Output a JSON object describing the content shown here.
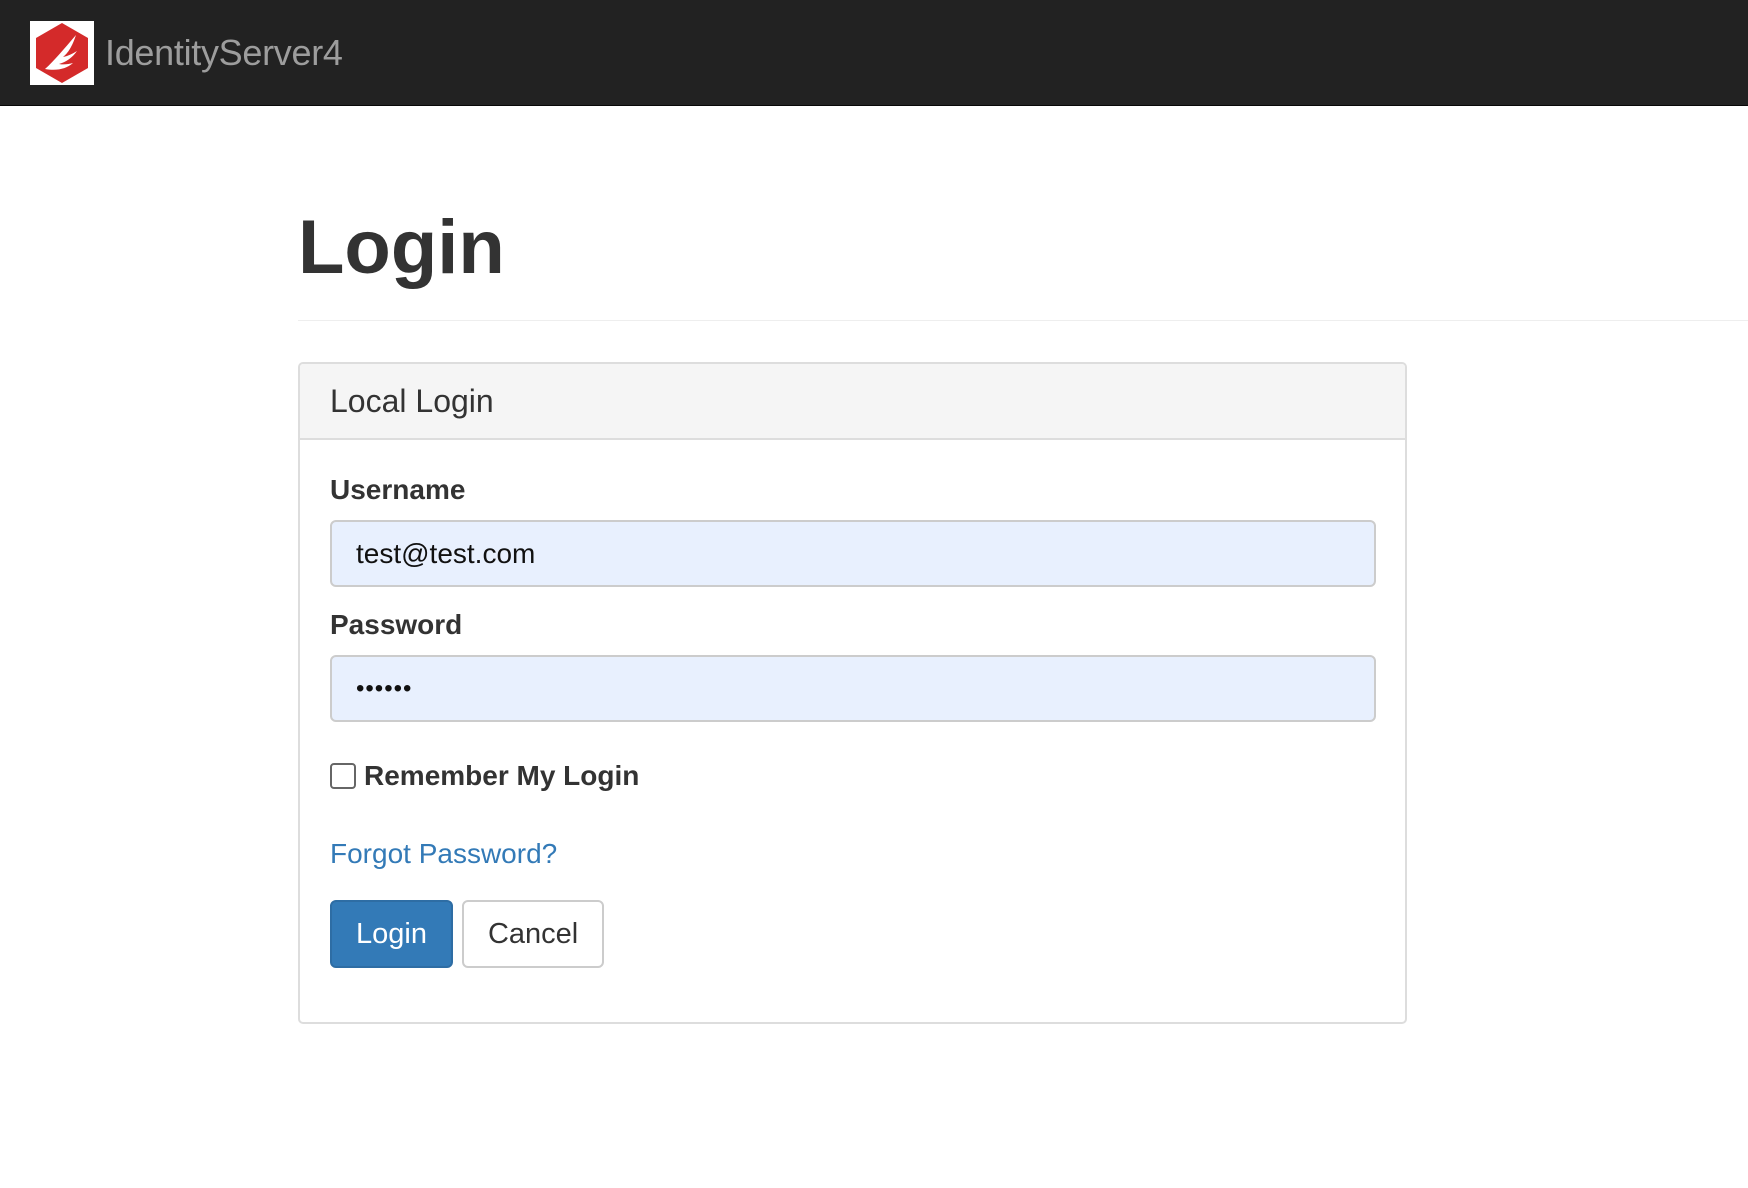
{
  "navbar": {
    "brand_name": "IdentityServer4",
    "logo_icon": "identityserver-logo-icon",
    "background_color": "#222222"
  },
  "page": {
    "title": "Login"
  },
  "local_login": {
    "heading": "Local Login",
    "username": {
      "label": "Username",
      "value": "test@test.com"
    },
    "password": {
      "label": "Password",
      "value": "••••••"
    },
    "remember": {
      "label": "Remember My Login",
      "checked": false
    },
    "forgot_password": "Forgot Password?",
    "buttons": {
      "login": "Login",
      "cancel": "Cancel"
    },
    "colors": {
      "primary": "#337ab7",
      "link": "#337ab7",
      "input_autofill": "#e8f0fe"
    }
  }
}
